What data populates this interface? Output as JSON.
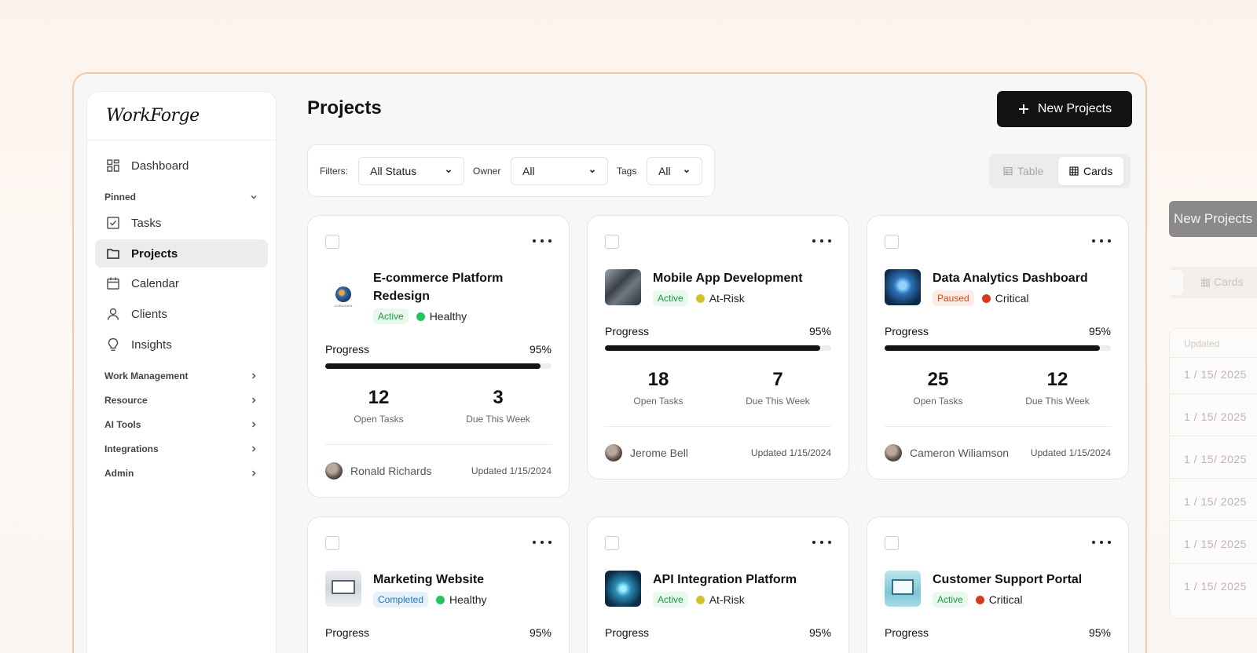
{
  "brand": "WorkForge",
  "sidebar": {
    "dashboard": "Dashboard",
    "pinned": "Pinned",
    "tasks": "Tasks",
    "projects": "Projects",
    "calendar": "Calendar",
    "clients": "Clients",
    "insights": "Insights",
    "groups": [
      "Work Management",
      "Resource",
      "AI Tools",
      "Integrations",
      "Admin"
    ]
  },
  "header": {
    "title": "Projects",
    "new_button": "New Projects"
  },
  "filters": {
    "label": "Filters:",
    "status_value": "All Status",
    "owner_label": "Owner",
    "owner_value": "All",
    "tags_label": "Tags",
    "tags_value": "All"
  },
  "view_toggle": {
    "table": "Table",
    "cards": "Cards",
    "selected": "Cards"
  },
  "projects": [
    {
      "title": "E-commerce Platform Redesign",
      "status": "Active",
      "health": "Healthy",
      "health_color": "#22c55e",
      "progress_label": "Progress",
      "progress": "95%",
      "open_tasks": "12",
      "open_label": "Open Tasks",
      "due": "3",
      "due_label": "Due This Week",
      "owner": "Ronald Richards",
      "updated": "Updated 1/15/2024",
      "thumb_caption": "CORAGAEA"
    },
    {
      "title": "Mobile App Development",
      "status": "Active",
      "health": "At-Risk",
      "health_color": "#d4c12b",
      "progress_label": "Progress",
      "progress": "95%",
      "open_tasks": "18",
      "open_label": "Open Tasks",
      "due": "7",
      "due_label": "Due This Week",
      "owner": "Jerome Bell",
      "updated": "Updated 1/15/2024"
    },
    {
      "title": "Data Analytics Dashboard",
      "status": "Paused",
      "health": "Critical",
      "health_color": "#d9391e",
      "progress_label": "Progress",
      "progress": "95%",
      "open_tasks": "25",
      "open_label": "Open Tasks",
      "due": "12",
      "due_label": "Due This Week",
      "owner": "Cameron Wiliamson",
      "updated": "Updated 1/15/2024"
    },
    {
      "title": "Marketing Website",
      "status": "Completed",
      "health": "Healthy",
      "health_color": "#22c55e",
      "progress_label": "Progress",
      "progress": "95%"
    },
    {
      "title": "API Integration Platform",
      "status": "Active",
      "health": "At-Risk",
      "health_color": "#d4c12b",
      "progress_label": "Progress",
      "progress": "95%"
    },
    {
      "title": "Customer Support Portal",
      "status": "Active",
      "health": "Critical",
      "health_color": "#d9391e",
      "progress_label": "Progress",
      "progress": "95%"
    }
  ],
  "background_panel": {
    "button": "New Projects",
    "cards_label": "Cards",
    "column_header": "Updated",
    "rows": [
      "1 / 15/ 2025",
      "1 / 15/ 2025",
      "1 / 15/ 2025",
      "1 / 15/ 2025",
      "1 / 15/ 2025",
      "1 / 15/ 2025"
    ]
  }
}
